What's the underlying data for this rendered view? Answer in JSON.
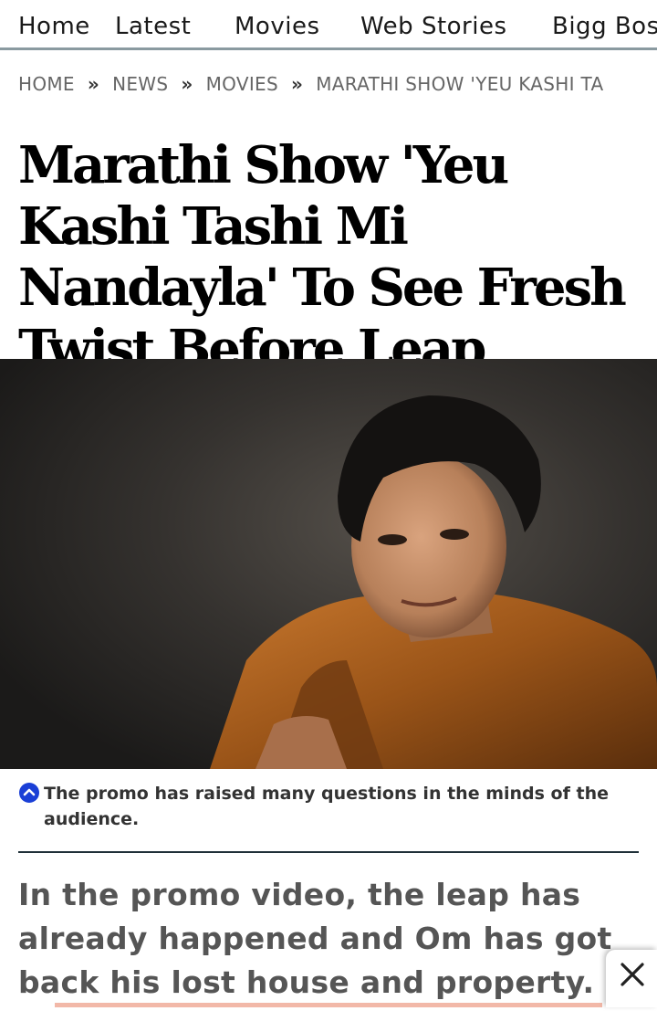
{
  "nav": {
    "items": [
      "Home",
      "Latest",
      "Movies",
      "Web Stories",
      "Bigg Bos"
    ]
  },
  "breadcrumb": {
    "items": [
      "HOME",
      "NEWS",
      "MOVIES",
      "MARATHI SHOW 'YEU KASHI TA"
    ],
    "separator": "»"
  },
  "article": {
    "headline": "Marathi Show 'Yeu Kashi Tashi Mi Nandayla' To See Fresh Twist Before Leap",
    "caption": "The promo has raised many questions in the minds of the audience.",
    "summary": "In the promo video, the leap has already happened and Om has got back his lost house and property."
  },
  "icons": {
    "caption_toggle": "chevron-up-circle-icon",
    "close": "close-icon"
  },
  "colors": {
    "nav_border": "#8a9aa0",
    "caption_icon": "#1a3fd6",
    "bottom_bar": "#f2b8a8"
  }
}
